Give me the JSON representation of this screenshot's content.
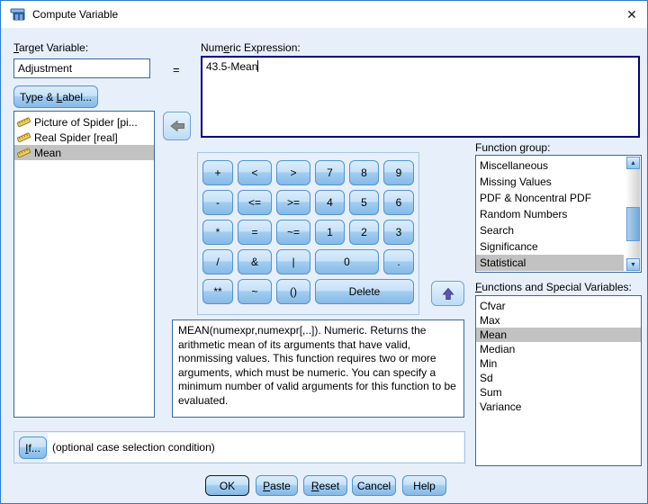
{
  "window": {
    "title": "Compute Variable",
    "close_glyph": "✕"
  },
  "target": {
    "label": {
      "pre": "",
      "u": "T",
      "post": "arget Variable:"
    },
    "value": "Adjustment",
    "equals": "=",
    "type_label_button": {
      "pre": "Type & ",
      "u": "L",
      "post": "abel..."
    }
  },
  "variables": {
    "items": [
      {
        "label": "Picture of Spider [pi...",
        "selected": false
      },
      {
        "label": "Real Spider [real]",
        "selected": false
      },
      {
        "label": "Mean",
        "selected": true
      }
    ]
  },
  "expression": {
    "label": {
      "pre": "Num",
      "u": "e",
      "post": "ric Expression:"
    },
    "value": "43.5-Mean"
  },
  "keypad": {
    "buttons": [
      "+",
      "<",
      ">",
      "7",
      "8",
      "9",
      "-",
      "<=",
      ">=",
      "4",
      "5",
      "6",
      "*",
      "=",
      "~=",
      "1",
      "2",
      "3",
      "/",
      "&",
      "|",
      "0",
      ".",
      "**",
      "~",
      "()",
      "Delete"
    ]
  },
  "function_group": {
    "label": {
      "pre": "Function ",
      "u": "g",
      "post": "roup:"
    },
    "items": [
      "Miscellaneous",
      "Missing Values",
      "PDF & Noncentral PDF",
      "Random Numbers",
      "Search",
      "Significance",
      "Statistical"
    ],
    "selected": "Statistical"
  },
  "functions": {
    "label": {
      "pre": "",
      "u": "F",
      "post": "unctions and Special Variables:"
    },
    "items": [
      "Cfvar",
      "Max",
      "Mean",
      "Median",
      "Min",
      "Sd",
      "Sum",
      "Variance"
    ],
    "selected": "Mean"
  },
  "description": "MEAN(numexpr,numexpr[,..]). Numeric. Returns the arithmetic mean of its arguments that have valid, nonmissing values. This function requires two or more arguments, which must be numeric. You can specify a minimum number of valid arguments for this function to be evaluated.",
  "if_row": {
    "button": {
      "pre": "",
      "u": "I",
      "post": "f..."
    },
    "text": "(optional case selection condition)"
  },
  "actions": {
    "ok": "OK",
    "paste": {
      "pre": "",
      "u": "P",
      "post": "aste"
    },
    "reset": {
      "pre": "",
      "u": "R",
      "post": "eset"
    },
    "cancel": "Cancel",
    "help": "Help"
  },
  "colors": {
    "accent": "#2b7bd0",
    "selection_gray": "#c2c2c2",
    "focus_border": "#00007f"
  }
}
